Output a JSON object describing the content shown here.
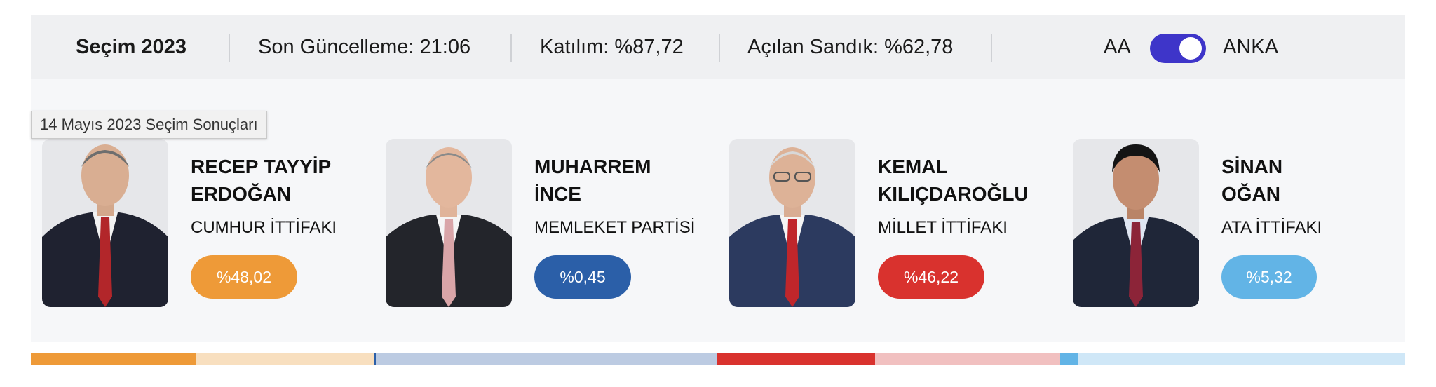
{
  "header": {
    "title": "Seçim 2023",
    "update_label": "Son Güncelleme:",
    "update_value": "21:06",
    "turnout_label": "Katılım:",
    "turnout_value": "%87,72",
    "opened_label": "Açılan Sandık:",
    "opened_value": "%62,78",
    "source_left": "AA",
    "source_right": "ANKA",
    "toggle_state": "on"
  },
  "tooltip": "14 Mayıs 2023 Seçim Sonuçları",
  "candidates": [
    {
      "name": "RECEP TAYYİP\nERDOĞAN",
      "party": "CUMHUR İTTİFAKI",
      "percent": "%48,02",
      "color": "#ee9a38"
    },
    {
      "name": "MUHARREM\nİNCE",
      "party": "MEMLEKET PARTİSİ",
      "percent": "%0,45",
      "color": "#2b5fa8"
    },
    {
      "name": "KEMAL\nKILIÇDAROĞLU",
      "party": "MİLLET İTTİFAKI",
      "percent": "%46,22",
      "color": "#d9322e"
    },
    {
      "name": "SİNAN\nOĞAN",
      "party": "ATA İTTİFAKI",
      "percent": "%5,32",
      "color": "#62b4e6"
    }
  ],
  "results_bar": [
    {
      "candidate": "ERDOĞAN",
      "share": 0.4802,
      "color": "#ee9a38",
      "light": "#f8dfbf"
    },
    {
      "candidate": "İNCE",
      "share": 0.0045,
      "color": "#2b5fa8",
      "light": "#bccbe2"
    },
    {
      "candidate": "KILIÇDAROĞLU",
      "share": 0.4622,
      "color": "#d9322e",
      "light": "#f1c0c0"
    },
    {
      "candidate": "OĞAN",
      "share": 0.0532,
      "color": "#62b4e6",
      "light": "#cfe7f7"
    }
  ]
}
